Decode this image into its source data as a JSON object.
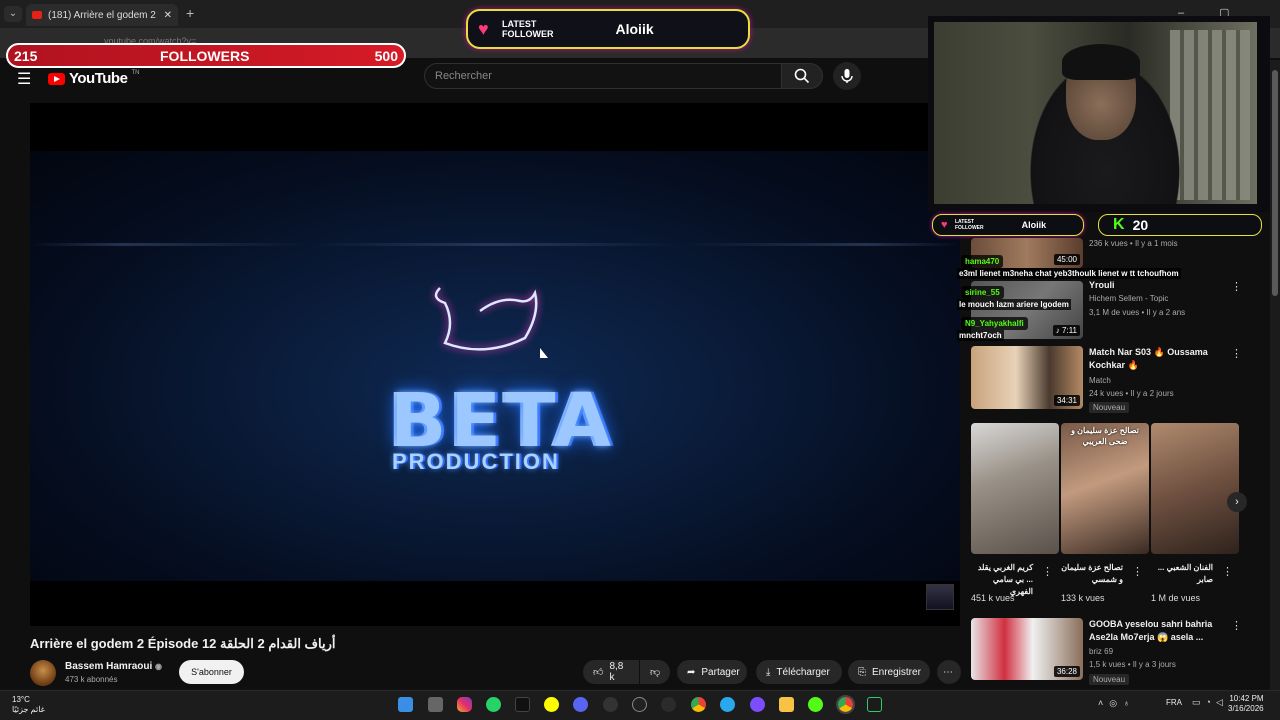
{
  "browser": {
    "tab_title": "(181) Arrière el godem 2 Épisode",
    "tab_menu": "⌄",
    "new_tab": "+",
    "url": "youtube.com/watch?v=...",
    "window_controls": "– ▢ ✕"
  },
  "overlay": {
    "followers_current": "215",
    "followers_label": "FOLLOWERS",
    "followers_goal": "500",
    "latest_follower_label_1": "LATEST",
    "latest_follower_label_2": "FOLLOWER",
    "latest_follower_name": "Aloiik",
    "kick_viewers": "20",
    "kick_logo": "K"
  },
  "youtube": {
    "logo_text": "YouTube",
    "logo_region": "TN",
    "search_placeholder": "Rechercher",
    "video": {
      "brand_main": "BETA",
      "brand_sub": "PRODUCTION",
      "title": "Arrière el godem 2 Épisode 12 أرياف القدام 2 الحلقة",
      "channel": "Bassem Hamraoui",
      "verified": "◉",
      "subscribers": "473 k abonnés",
      "subscribe": "S'abonner",
      "likes": "8,8 k",
      "share": "Partager",
      "download": "Télécharger",
      "save": "Enregistrer",
      "more": "⋯"
    }
  },
  "sidebar": {
    "items": [
      {
        "title": "",
        "channel": "",
        "meta": "236 k vues • Il y a 1 mois",
        "duration": "45:00"
      },
      {
        "title": "Yrouli",
        "channel": "Hichem Sellem - Topic",
        "meta": "3,1 M de vues • Il y a 2 ans",
        "duration": "♪ 7:11"
      },
      {
        "title": "Match Nar S03 🔥 Oussama Kochkar 🔥",
        "channel": "Match",
        "meta": "24 k vues • Il y a 2 jours",
        "badge": "Nouveau",
        "duration": "34:31"
      },
      {
        "title": "GOOBA yeselou sahri bahria Ase2la Mo7erja 😱 asela ...",
        "channel": "briz 69",
        "meta": "1,5 k vues • Il y a 3 jours",
        "badge": "Nouveau",
        "duration": "36:28"
      }
    ],
    "shorts": [
      {
        "title": "كريم الغربي يقلد ... بي سامي الفهري",
        "views": "451 k vues"
      },
      {
        "title": "تصالح عزة سليمان و شمسي",
        "views": "133 k vues",
        "caption": "تصالح عزة سليمان و ضحى العريبي"
      },
      {
        "title": "الفنان الشعبي ... صابر",
        "views": "1 M de vues"
      }
    ]
  },
  "chat": [
    {
      "name": "hama470",
      "msg": "e3ml lienet m3neha chat yeb3thoulk lienet w tt tchoufhom"
    },
    {
      "name": "sirine_55",
      "msg": "le mouch lazm ariere lgodem"
    },
    {
      "name": "N9_Yahyakhalfi",
      "msg": "mncht7och"
    }
  ],
  "taskbar": {
    "temp": "13°C",
    "weather_text": "غائم جزئيًا",
    "lang": "FRA",
    "time": "10:42 PM",
    "date": "3/16/2026"
  },
  "colors": {
    "accent_red": "#ff0000",
    "kick_green": "#53fc18",
    "overlay_yellow": "#e6e13a",
    "followers_red": "#d61b27"
  }
}
